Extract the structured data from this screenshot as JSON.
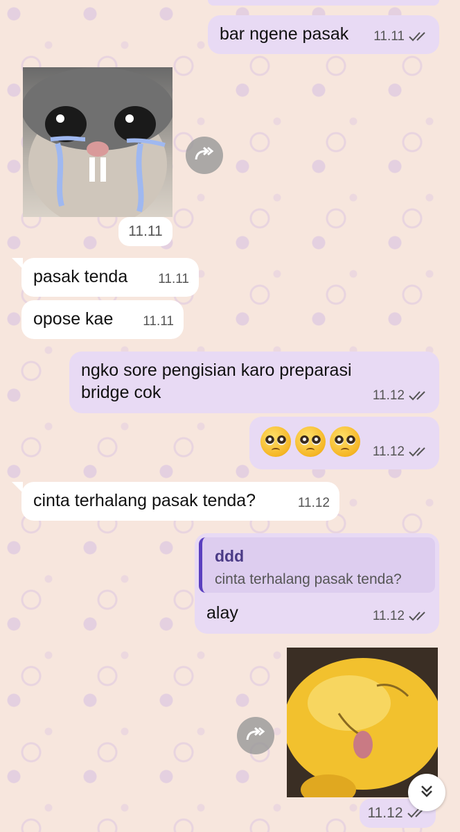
{
  "messages": [
    {
      "id": "m1",
      "direction": "out",
      "text": "bar ngene pasak",
      "time": "11.11",
      "read": true
    },
    {
      "id": "m2",
      "direction": "in",
      "type": "photo",
      "photo": "crying-cat-sticker-image",
      "time": "11.11"
    },
    {
      "id": "m3",
      "direction": "in",
      "text": "pasak tenda",
      "time": "11.11"
    },
    {
      "id": "m4",
      "direction": "in",
      "text": "opose kae",
      "time": "11.11"
    },
    {
      "id": "m5",
      "direction": "out",
      "text_line1": "ngko sore pengisian karo preparasi",
      "text_line2": "bridge cok",
      "time": "11.12",
      "read": true
    },
    {
      "id": "m6",
      "direction": "out",
      "type": "emoji",
      "emojis": [
        "pleading-face",
        "pleading-face",
        "pleading-face"
      ],
      "time": "11.12",
      "read": true
    },
    {
      "id": "m7",
      "direction": "in",
      "text": "cinta terhalang pasak tenda?",
      "time": "11.12"
    },
    {
      "id": "m8",
      "direction": "out",
      "reply_to": {
        "name": "ddd",
        "text": "cinta terhalang pasak tenda?"
      },
      "text": "alay",
      "time": "11.12",
      "read": true
    },
    {
      "id": "m9",
      "direction": "out",
      "type": "photo",
      "photo": "yellow-duck-sticker-image",
      "time": "11.12",
      "read": true
    }
  ],
  "icons": {
    "forward": "forward-icon",
    "read_receipt": "double-check-icon",
    "scroll_down": "chevron-double-down-icon"
  },
  "colors": {
    "outgoing_bubble": "#e8daf4",
    "incoming_bubble": "#ffffff",
    "wallpaper": "#f7e6dd",
    "quote_bar": "#5a3fbf"
  }
}
